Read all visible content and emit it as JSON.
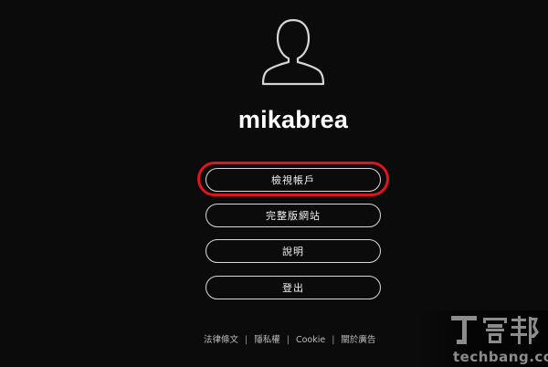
{
  "profile": {
    "username": "mikabrea",
    "avatar_icon": "user-silhouette-icon"
  },
  "menu": {
    "items": [
      {
        "label": "檢視帳戶",
        "highlighted": true
      },
      {
        "label": "完整版網站"
      },
      {
        "label": "說明"
      },
      {
        "label": "登出"
      }
    ]
  },
  "footer": {
    "links": [
      "法律條文",
      "隱私權",
      "Cookie",
      "關於廣告"
    ]
  },
  "watermark": {
    "brand_cn": "T客邦",
    "brand_en": "techbang.com"
  },
  "colors": {
    "background": "#0b0b0b",
    "highlight": "#e0141c",
    "button_border": "#d9d9d9"
  }
}
